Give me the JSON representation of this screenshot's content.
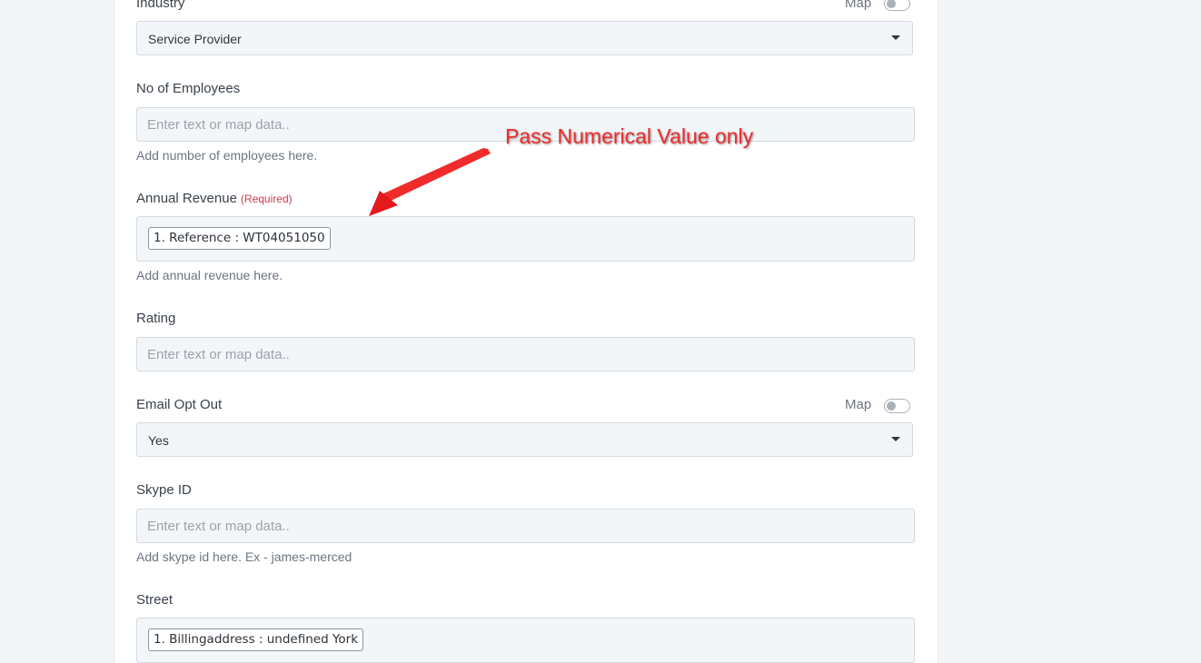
{
  "fields": {
    "industry": {
      "label": "Industry",
      "map_label": "Map",
      "value": "Service Provider"
    },
    "employees": {
      "label": "No of Employees",
      "placeholder": "Enter text or map data..",
      "hint": "Add number of employees here."
    },
    "annual_revenue": {
      "label": "Annual Revenue",
      "required": "(Required)",
      "chip": "1. Reference : WT04051050",
      "hint": "Add annual revenue here."
    },
    "rating": {
      "label": "Rating",
      "placeholder": "Enter text or map data.."
    },
    "email_opt_out": {
      "label": "Email Opt Out",
      "map_label": "Map",
      "value": "Yes"
    },
    "skype": {
      "label": "Skype ID",
      "placeholder": "Enter text or map data..",
      "hint": "Add skype id here. Ex - james-merced"
    },
    "street": {
      "label": "Street",
      "chip": "1. Billingaddress : undefined York"
    }
  },
  "annotation": {
    "text": "Pass Numerical Value only",
    "color": "#ef2b2b"
  },
  "colors": {
    "background": "#f3f6f9",
    "panel": "#ffffff",
    "required": "#d6384b",
    "field_bg": "#f3f6f9",
    "field_border": "#d3d9df"
  }
}
